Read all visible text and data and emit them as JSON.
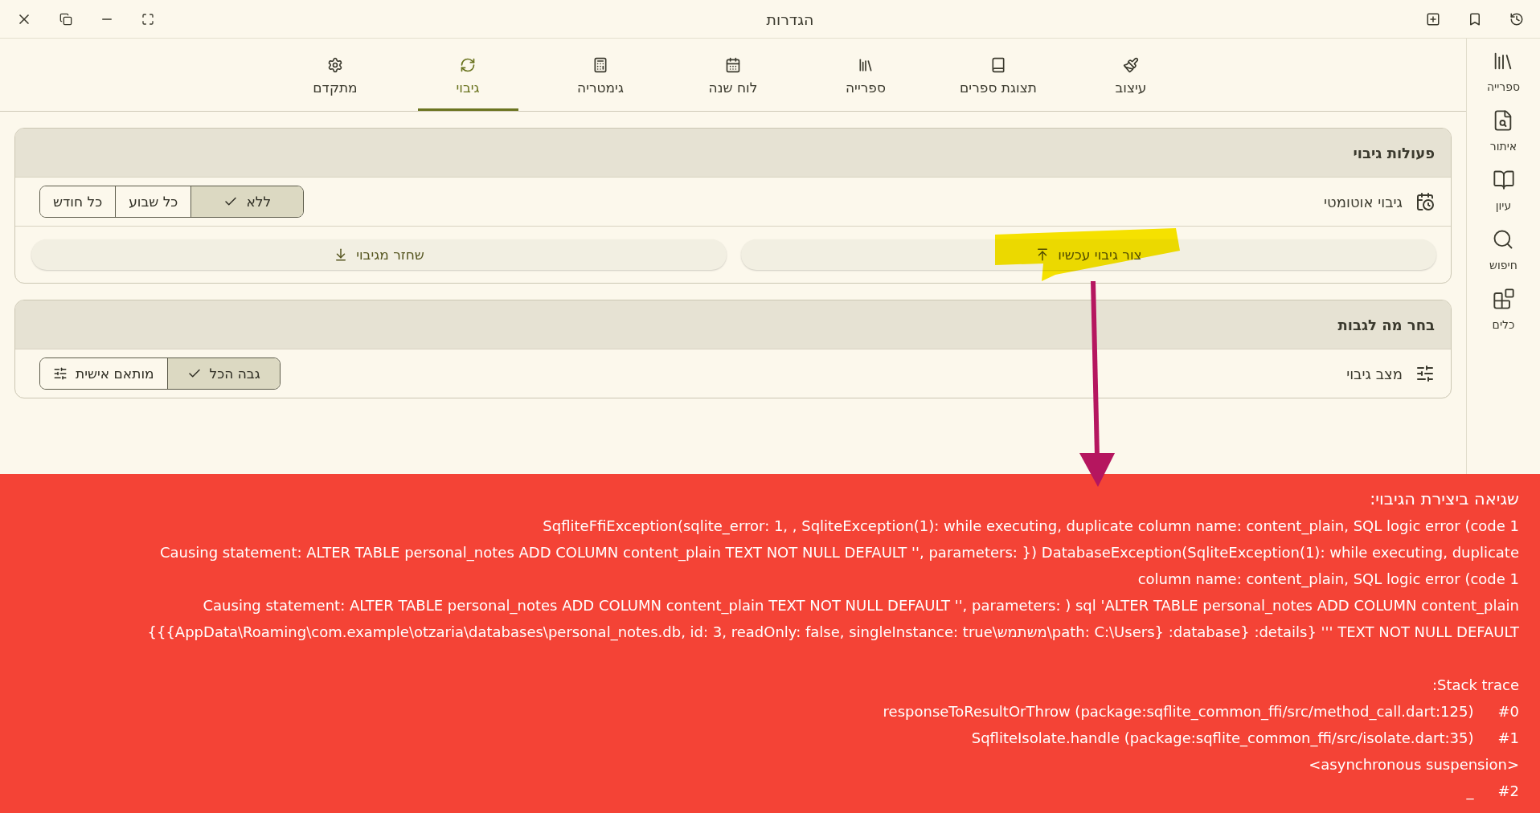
{
  "window": {
    "title": "הגדרות"
  },
  "tabs": [
    {
      "label": "עיצוב",
      "selected": false
    },
    {
      "label": "תצוגת ספרים",
      "selected": false
    },
    {
      "label": "ספרייה",
      "selected": false
    },
    {
      "label": "לוח שנה",
      "selected": false
    },
    {
      "label": "גימטריה",
      "selected": false
    },
    {
      "label": "גיבוי",
      "selected": true
    },
    {
      "label": "מתקדם",
      "selected": false
    }
  ],
  "sidebar": {
    "items": [
      {
        "label": "ספרייה"
      },
      {
        "label": "איתור"
      },
      {
        "label": "עיון"
      },
      {
        "label": "חיפוש"
      },
      {
        "label": "כלים"
      }
    ]
  },
  "sections": [
    {
      "title": "פעולות גיבוי",
      "rows": [
        {
          "kind": "segmented",
          "label": "גיבוי אוטומטי",
          "options": [
            {
              "label": "ללא",
              "kind": "plain",
              "selected": true
            },
            {
              "label": "כל שבוע",
              "kind": "plain",
              "selected": false
            },
            {
              "label": "כל חודש",
              "kind": "plain",
              "selected": false
            }
          ]
        },
        {
          "kind": "buttons",
          "buttons": [
            {
              "label": "צור גיבוי עכשיו",
              "kind": "create"
            },
            {
              "label": "שחזר מגיבוי",
              "kind": "restore"
            }
          ]
        }
      ]
    },
    {
      "title": "בחר מה לגבות",
      "rows": [
        {
          "kind": "segmented",
          "label": "מצב גיבוי",
          "options": [
            {
              "label": "גבה הכל",
              "kind": "plain",
              "selected": true
            },
            {
              "label": "מותאם אישית",
              "kind": "custom",
              "selected": false
            }
          ]
        }
      ]
    }
  ],
  "error": {
    "title": "שגיאה ביצירת הגיבוי:",
    "lines": [
      "SqfliteFfiException(sqlite_error: 1, , SqliteException(1): while executing, duplicate column name: content_plain, SQL logic error (code 1",
      "Causing statement: ALTER TABLE personal_notes ADD COLUMN content_plain TEXT NOT NULL DEFAULT '', parameters: }) DatabaseException(SqliteException(1): while executing, duplicate",
      "column name: content_plain, SQL logic error (code 1",
      "Causing statement: ALTER TABLE personal_notes ADD COLUMN content_plain TEXT NOT NULL DEFAULT '', parameters: ) sql 'ALTER TABLE personal_notes ADD COLUMN content_plain",
      "{{{AppData\\Roaming\\com.example\\otzaria\\databases\\personal_notes.db, id: 3, readOnly: false, singleInstance: true\\משתמש\\path: C:\\Users} :database} :details} ''' TEXT NOT NULL DEFAULT"
    ],
    "stack_title": ":Stack trace",
    "stack": [
      {
        "text": "responseToResultOrThrow (package:sqflite_common_ffi/src/method_call.dart:125)",
        "index": "#0"
      },
      {
        "text": "SqfliteIsolate.handle (package:sqflite_common_ffi/src/isolate.dart:35)",
        "index": "#1"
      },
      {
        "text": "<asynchronous suspension>"
      },
      {
        "text": "_",
        "index": "#2"
      }
    ]
  },
  "annotations": {
    "highlight": true,
    "arrow": true
  }
}
